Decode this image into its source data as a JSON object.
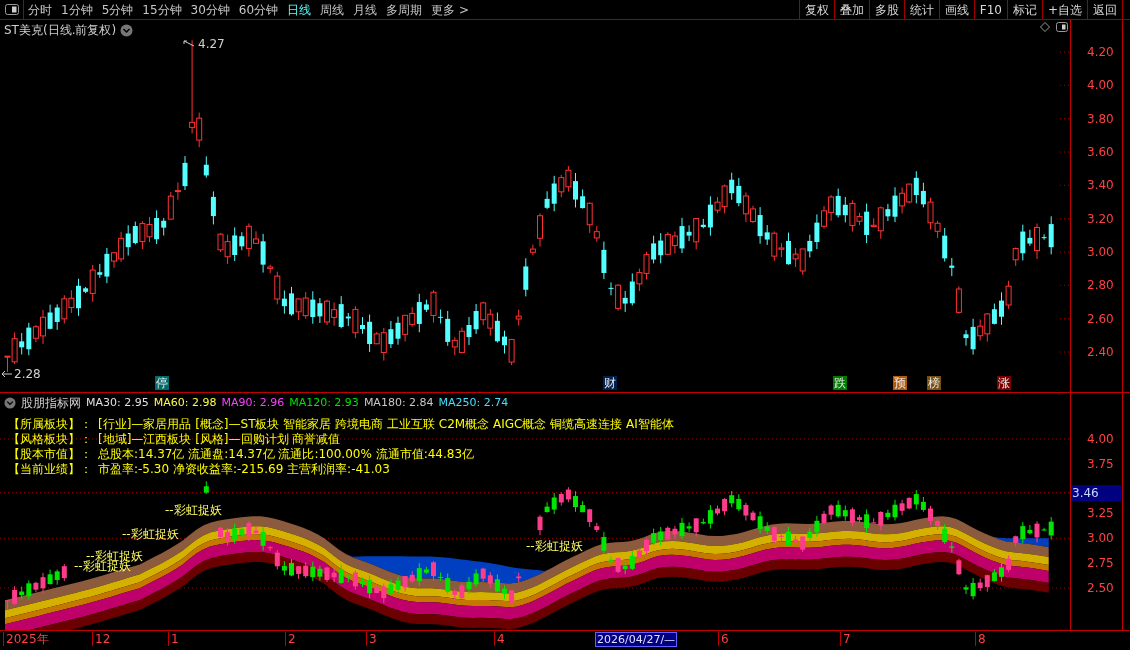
{
  "toolbar": {
    "periods": [
      {
        "label": "分时",
        "selected": false
      },
      {
        "label": "1分钟",
        "selected": false
      },
      {
        "label": "5分钟",
        "selected": false
      },
      {
        "label": "15分钟",
        "selected": false
      },
      {
        "label": "30分钟",
        "selected": false
      },
      {
        "label": "60分钟",
        "selected": false
      },
      {
        "label": "日线",
        "selected": true
      },
      {
        "label": "周线",
        "selected": false
      },
      {
        "label": "月线",
        "selected": false
      },
      {
        "label": "多周期",
        "selected": false
      },
      {
        "label": "更多 >",
        "selected": false
      }
    ],
    "actions": [
      "复权",
      "叠加",
      "多股",
      "统计",
      "画线",
      "F10",
      "标记",
      "+自选",
      "返回"
    ]
  },
  "main_chart": {
    "title": "ST美克(日线.前复权)",
    "high_label": "4.27",
    "low_label": "2.28",
    "y_axis": [
      "4.20",
      "4.00",
      "3.80",
      "3.60",
      "3.40",
      "3.20",
      "3.00",
      "2.80",
      "2.60",
      "2.40"
    ],
    "events": [
      {
        "label": "停",
        "color": "#006a6a"
      },
      {
        "label": "财",
        "color": "#002050"
      },
      {
        "label": "跌",
        "color": "#007a00"
      },
      {
        "label": "预",
        "color": "#b05a10"
      },
      {
        "label": "榜",
        "color": "#7a5010"
      },
      {
        "label": "涨",
        "color": "#7a0000"
      }
    ]
  },
  "indicator": {
    "name": "股朋指标网",
    "mas": [
      {
        "label": "MA30: 2.95",
        "color": "#e0e0e0"
      },
      {
        "label": "MA60: 2.98",
        "color": "#ffff40"
      },
      {
        "label": "MA90: 2.96",
        "color": "#ff40ff"
      },
      {
        "label": "MA120: 2.93",
        "color": "#00e000"
      },
      {
        "label": "MA180: 2.84",
        "color": "#c8c8c8"
      },
      {
        "label": "MA250: 2.74",
        "color": "#40e0ff"
      }
    ],
    "info": [
      {
        "key": "【所属板块】：",
        "value": "[行业]—家居用品 [概念]—ST板块 智能家居 跨境电商 工业互联 C2M概念 AIGC概念 铜缆高速连接 AI智能体"
      },
      {
        "key": "【风格板块】：",
        "value": "[地域]—江西板块 [风格]—回购计划 商誉减值"
      },
      {
        "key": "【股本市值】：",
        "value": "总股本:14.37亿 流通盘:14.37亿 流通比:100.00% 流通市值:44.83亿"
      },
      {
        "key": "【当前业绩】：",
        "value": "市盈率:-5.30 净资收益率:-215.69 主营利润率:-41.03"
      }
    ],
    "signals": [
      "--彩虹捉妖",
      "--彩虹捉妖",
      "--彩虹捉妖",
      "--彩虹捉妖",
      "--彩虹捉妖"
    ],
    "y_axis": [
      "4.00",
      "3.75",
      "3.25",
      "3.00",
      "2.75",
      "2.50"
    ],
    "current_price": "3.46"
  },
  "date_axis": [
    {
      "label": "2025年",
      "selected": false
    },
    {
      "label": "12",
      "selected": false
    },
    {
      "label": "1",
      "selected": false
    },
    {
      "label": "2",
      "selected": false
    },
    {
      "label": "3",
      "selected": false
    },
    {
      "label": "4",
      "selected": false
    },
    {
      "label": "2026/04/27/—",
      "selected": true
    },
    {
      "label": "6",
      "selected": false
    },
    {
      "label": "7",
      "selected": false
    },
    {
      "label": "8",
      "selected": false
    }
  ]
}
